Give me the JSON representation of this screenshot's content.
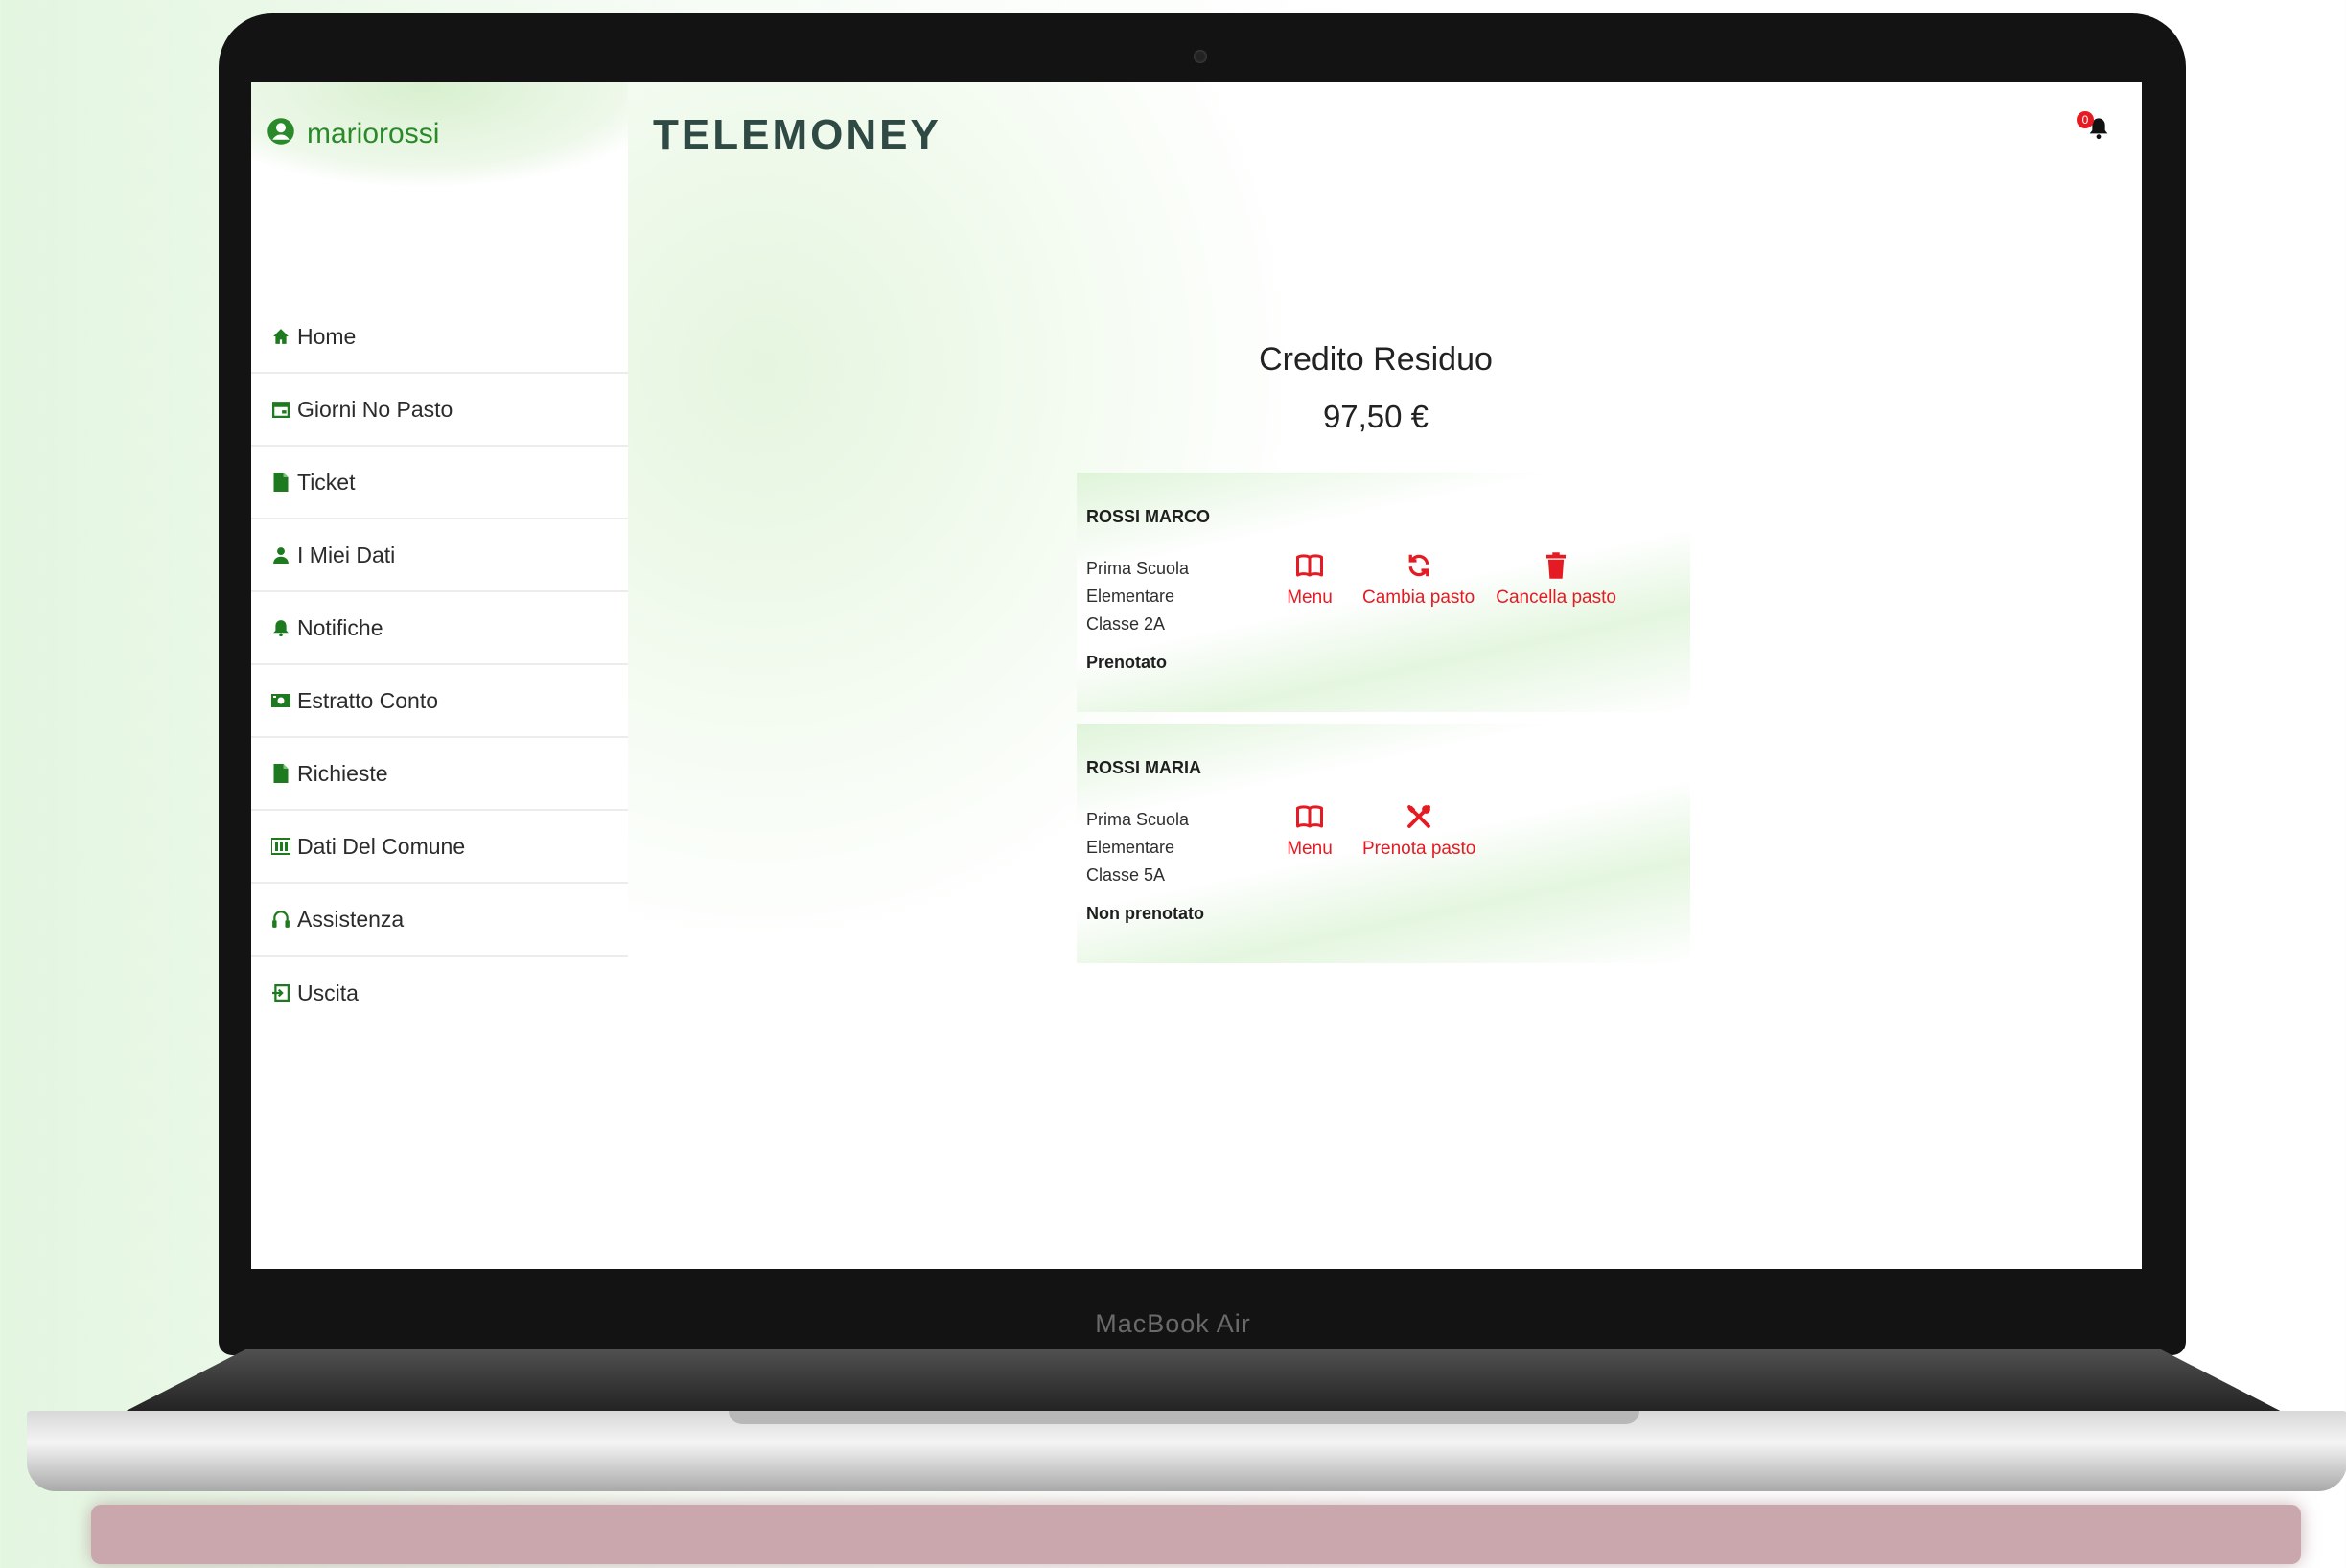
{
  "device": {
    "model_label": "MacBook Air"
  },
  "user": {
    "username": "mariorossi"
  },
  "brand": "TELEMONEY",
  "notifications": {
    "count": "0"
  },
  "sidebar": {
    "items": [
      {
        "label": "Home",
        "icon": "home-icon"
      },
      {
        "label": "Giorni No Pasto",
        "icon": "calendar-icon"
      },
      {
        "label": "Ticket",
        "icon": "file-icon"
      },
      {
        "label": "I Miei Dati",
        "icon": "user-icon"
      },
      {
        "label": "Notifiche",
        "icon": "bell-icon"
      },
      {
        "label": "Estratto Conto",
        "icon": "money-icon"
      },
      {
        "label": "Richieste",
        "icon": "file-icon"
      },
      {
        "label": "Dati Del Comune",
        "icon": "building-icon"
      },
      {
        "label": "Assistenza",
        "icon": "headphones-icon"
      },
      {
        "label": "Uscita",
        "icon": "logout-icon"
      }
    ]
  },
  "credit": {
    "title": "Credito Residuo",
    "value": "97,50 €"
  },
  "children": [
    {
      "name": "ROSSI MARCO",
      "school_lines": [
        "Prima Scuola",
        "Elementare",
        "Classe 2A"
      ],
      "status": "Prenotato",
      "actions": [
        {
          "label": "Menu",
          "icon": "book-icon"
        },
        {
          "label": "Cambia pasto",
          "icon": "refresh-icon"
        },
        {
          "label": "Cancella pasto",
          "icon": "trash-icon"
        }
      ]
    },
    {
      "name": "ROSSI MARIA",
      "school_lines": [
        "Prima Scuola",
        "Elementare",
        "Classe 5A"
      ],
      "status": "Non prenotato",
      "actions": [
        {
          "label": "Menu",
          "icon": "book-icon"
        },
        {
          "label": "Prenota pasto",
          "icon": "cutlery-icon"
        }
      ]
    }
  ],
  "colors": {
    "accent_green": "#2a8a2a",
    "action_red": "#e51b23"
  }
}
